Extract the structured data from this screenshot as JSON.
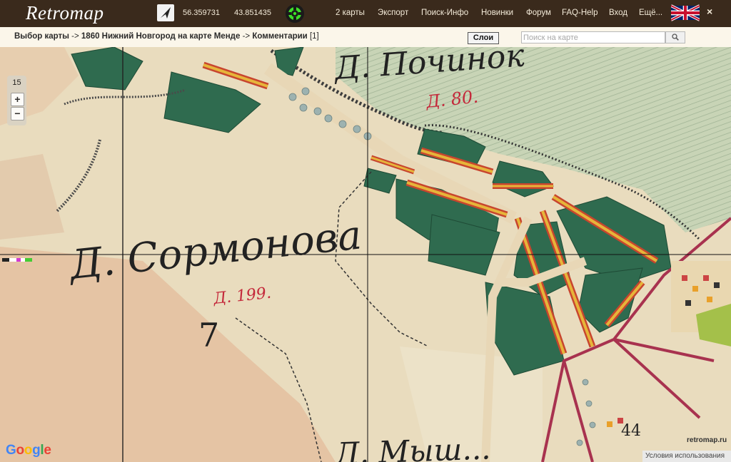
{
  "header": {
    "logo": "Retromap",
    "latitude": "56.359731",
    "longitude": "43.851435",
    "nav": [
      {
        "label": "2 карты"
      },
      {
        "label": "Экспорт"
      },
      {
        "label": "Поиск-Инфо"
      },
      {
        "label": "Новинки"
      },
      {
        "label": "Форум"
      },
      {
        "label": "FAQ-Help"
      },
      {
        "label": "Вход"
      },
      {
        "label": "Ещё..."
      }
    ],
    "close": "×",
    "icons": {
      "north": "north-arrow-icon",
      "gps": "gps-locate-icon",
      "language": "uk-flag-icon"
    }
  },
  "breadcrumb": {
    "item1": "Выбор карты",
    "sep1": "->",
    "item2": "1860 Нижний Новгород на карте Менде",
    "sep2": "->",
    "item3": "Комментарии",
    "count": "[1]"
  },
  "toolbar": {
    "layers_label": "Слои",
    "search_placeholder": "Поиск на карте",
    "search_icon": "search-icon"
  },
  "map": {
    "zoom": "15",
    "zoom_in": "+",
    "zoom_out": "−",
    "labels": {
      "village_main": "Д. Сормонова",
      "village_top": "Д. Починок",
      "village_bottom": "Д. Мыш...",
      "house_count_top": "Д. 80.",
      "house_count_mid": "Д. 199.",
      "num7": "7",
      "num44": "44"
    },
    "google": "Google",
    "site": "retromap.ru",
    "terms": "Условия использования"
  },
  "colors": {
    "topbar": "#3a2a1c",
    "parchment": "#e8d9b8",
    "forest": "#2f6b4f",
    "road_red": "#c8452e",
    "road_yellow": "#e6b53a",
    "red_text": "#c4283a"
  }
}
